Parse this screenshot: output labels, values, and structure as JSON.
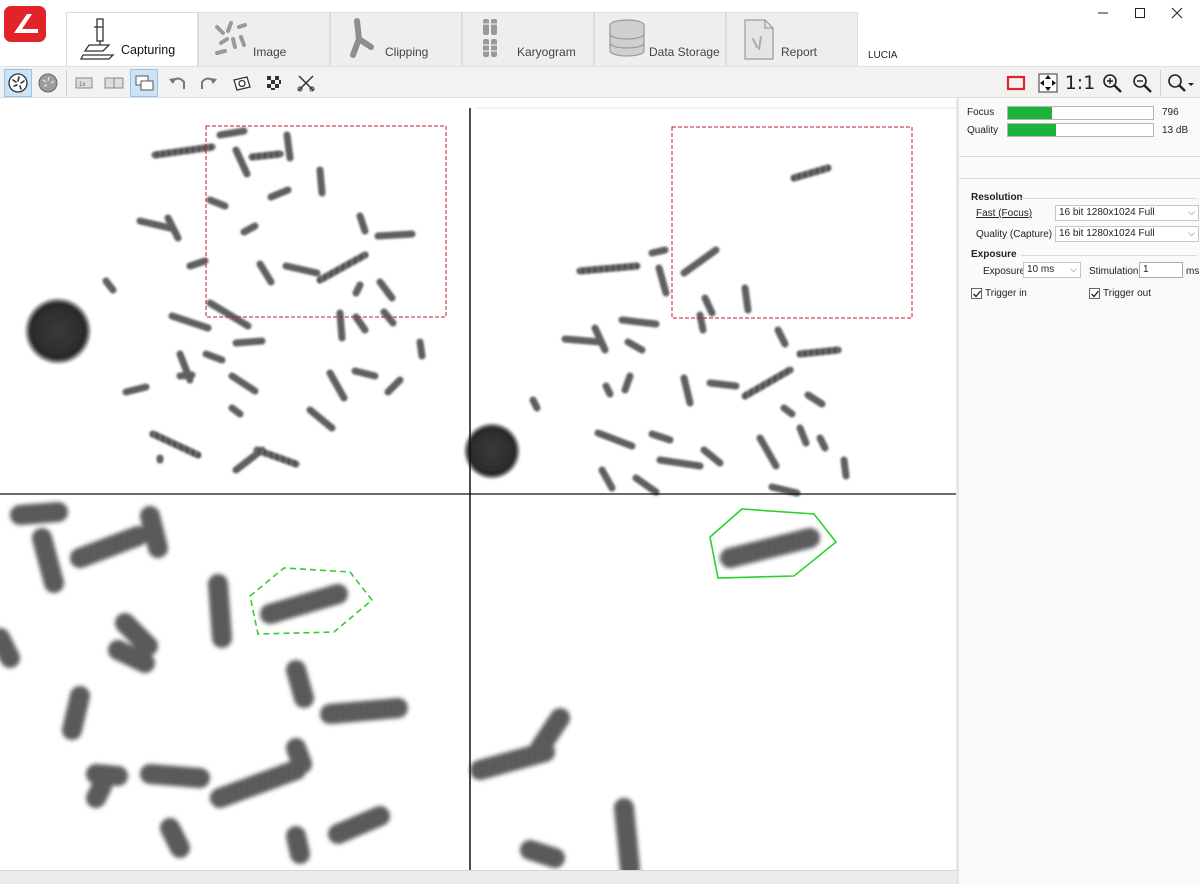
{
  "app": {
    "name": "LUCIA"
  },
  "tabs": [
    {
      "label": "Capturing",
      "active": true
    },
    {
      "label": "Image"
    },
    {
      "label": "Clipping"
    },
    {
      "label": "Karyogram"
    },
    {
      "label": "Data Storage"
    },
    {
      "label": "Report"
    }
  ],
  "window_controls": {
    "minimize": "—",
    "maximize": "☐",
    "close": "✕"
  },
  "toolbar": {
    "left_tools": [
      "live-view",
      "metaphase-finder",
      "single-view",
      "dual-view",
      "quad-view",
      "undo",
      "redo",
      "camera",
      "checkerboard",
      "scissors"
    ],
    "right_tools": [
      "region",
      "fit",
      "one-to-one",
      "zoom-in",
      "zoom-out",
      "zoom-menu"
    ],
    "one_to_one_label": "1:1"
  },
  "panel": {
    "focus": {
      "label": "Focus",
      "value": "796",
      "level": 0.3
    },
    "quality": {
      "label": "Quality",
      "value": "13 dB",
      "level": 0.33
    },
    "resolution": {
      "title": "Resolution",
      "fast_label": "Fast (Focus)",
      "fast_value": "16 bit  1280x1024 Full",
      "quality_label": "Quality (Capture)",
      "quality_value": "16 bit  1280x1024 Full"
    },
    "exposure": {
      "title": "Exposure",
      "exposure_label": "Exposure",
      "exposure_value": "10 ms",
      "stimulation_label": "Stimulation",
      "stimulation_value": "1",
      "stimulation_unit": "ms"
    },
    "trigger_in": {
      "label": "Trigger in",
      "checked": true
    },
    "trigger_out": {
      "label": "Trigger out",
      "checked": true
    }
  },
  "colors": {
    "accent_red": "#e2232a",
    "meter_green": "#1db33a",
    "outline_green": "#2ed12e",
    "selection_red": "#c0202a",
    "chromosome": "#555555"
  }
}
